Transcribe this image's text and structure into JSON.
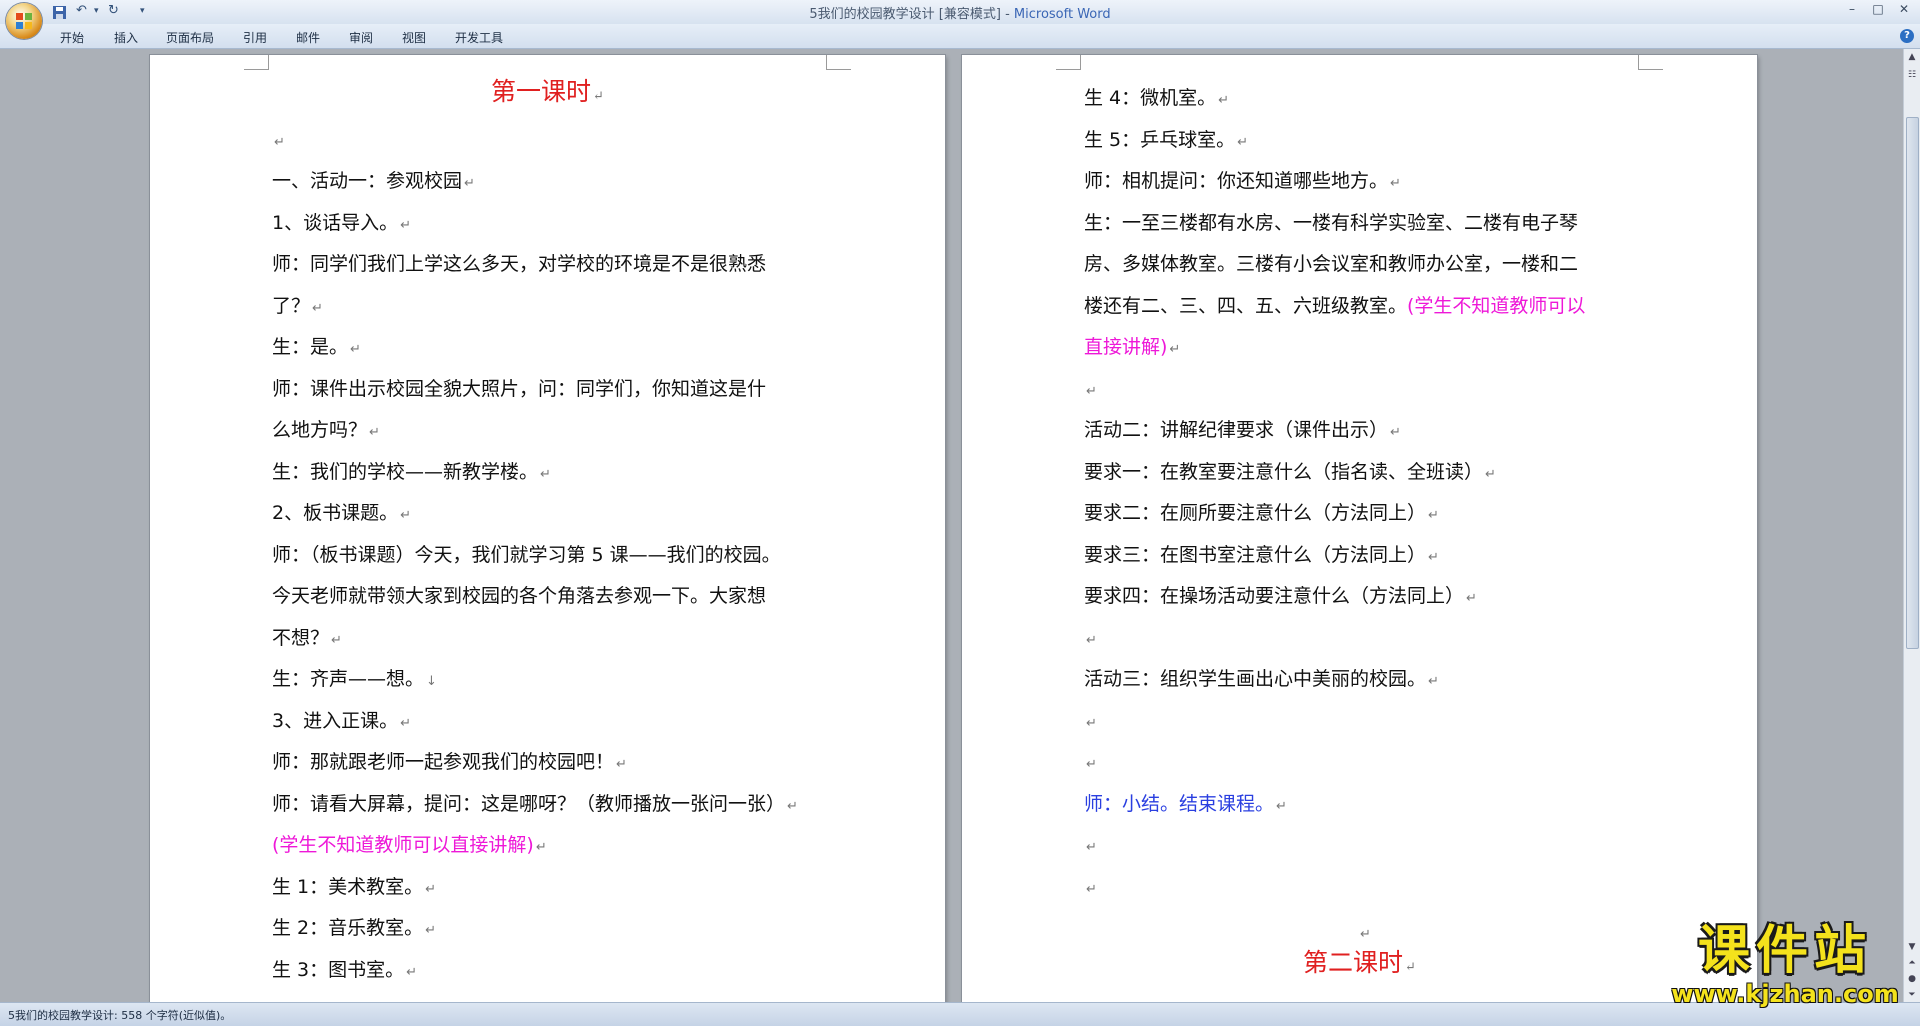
{
  "window": {
    "title_doc": "5我们的校园教学设计 [兼容模式]",
    "title_sep": " - ",
    "title_app": "Microsoft Word",
    "qat_redo": "↻",
    "qat_undo": "↶",
    "qat_more": "▾",
    "minimize": "–",
    "maximize": "□",
    "close": "✕"
  },
  "ribbon": {
    "tabs": [
      "开始",
      "插入",
      "页面布局",
      "引用",
      "邮件",
      "审阅",
      "视图",
      "开发工具"
    ],
    "help": "?"
  },
  "doc": {
    "left": [
      {
        "t": "第一课时"
      },
      {
        "t": ""
      },
      {
        "t": "一、活动一：参观校园"
      },
      {
        "t": "1、谈话导入。"
      },
      {
        "t": "师：同学们我们上学这么多天，对学校的环境是不是很熟悉"
      },
      {
        "t": "了？"
      },
      {
        "t": "生：是。"
      },
      {
        "t": "师：课件出示校园全貌大照片，问：同学们，你知道这是什"
      },
      {
        "t": "么地方吗？"
      },
      {
        "t": "生：我们的学校——新教学楼。"
      },
      {
        "t": "2、板书课题。"
      },
      {
        "t": "师：（板书课题）今天，我们就学习第 5 课——我们的校园。"
      },
      {
        "t": "今天老师就带领大家到校园的各个角落去参观一下。大家想"
      },
      {
        "t": "不想？"
      },
      {
        "t": "生：齐声——想。"
      },
      {
        "t": "3、进入正课。"
      },
      {
        "t": "师：那就跟老师一起参观我们的校园吧！"
      },
      {
        "t": "师：请看大屏幕，提问：这是哪呀？（教师播放一张问一张）"
      },
      {
        "t": "(学生不知道教师可以直接讲解)"
      },
      {
        "t": "生 1：美术教室。"
      },
      {
        "t": "生 2：音乐教室。"
      },
      {
        "t": "生 3：图书室。"
      }
    ],
    "right": [
      {
        "t": "生 4：微机室。"
      },
      {
        "t": "生 5：乒乓球室。"
      },
      {
        "t": "师：相机提问：你还知道哪些地方。"
      },
      {
        "t": "生：一至三楼都有水房、一楼有科学实验室、二楼有电子琴"
      },
      {
        "t": "房、多媒体教室。三楼有小会议室和教师办公室，一楼和二"
      },
      {
        "t": "楼还有二、三、四、五、六班级教室。",
        "t2": "(学生不知道教师可以"
      },
      {
        "t": "直接讲解)"
      },
      {
        "t": ""
      },
      {
        "t": "活动二：讲解纪律要求（课件出示）"
      },
      {
        "t": "要求一：在教室要注意什么（指名读、全班读）"
      },
      {
        "t": "要求二：在厕所要注意什么（方法同上）"
      },
      {
        "t": "要求三：在图书室注意什么（方法同上）"
      },
      {
        "t": "要求四：在操场活动要注意什么（方法同上）"
      },
      {
        "t": ""
      },
      {
        "t": "活动三：组织学生画出心中美丽的校园。"
      },
      {
        "t": ""
      },
      {
        "t": ""
      },
      {
        "t": "师：小结。结束课程。"
      },
      {
        "t": ""
      },
      {
        "t": ""
      },
      {
        "t": ""
      },
      {
        "t": "第二课时"
      }
    ]
  },
  "status": {
    "text": "5我们的校园教学设计: 558 个字符(近似值)。"
  },
  "watermark": {
    "title": "课件站",
    "url": "www.kjzhan.com"
  },
  "colors": {
    "heading": "#e02020",
    "note": "#ee18d8",
    "summary": "#2a3fe0"
  }
}
